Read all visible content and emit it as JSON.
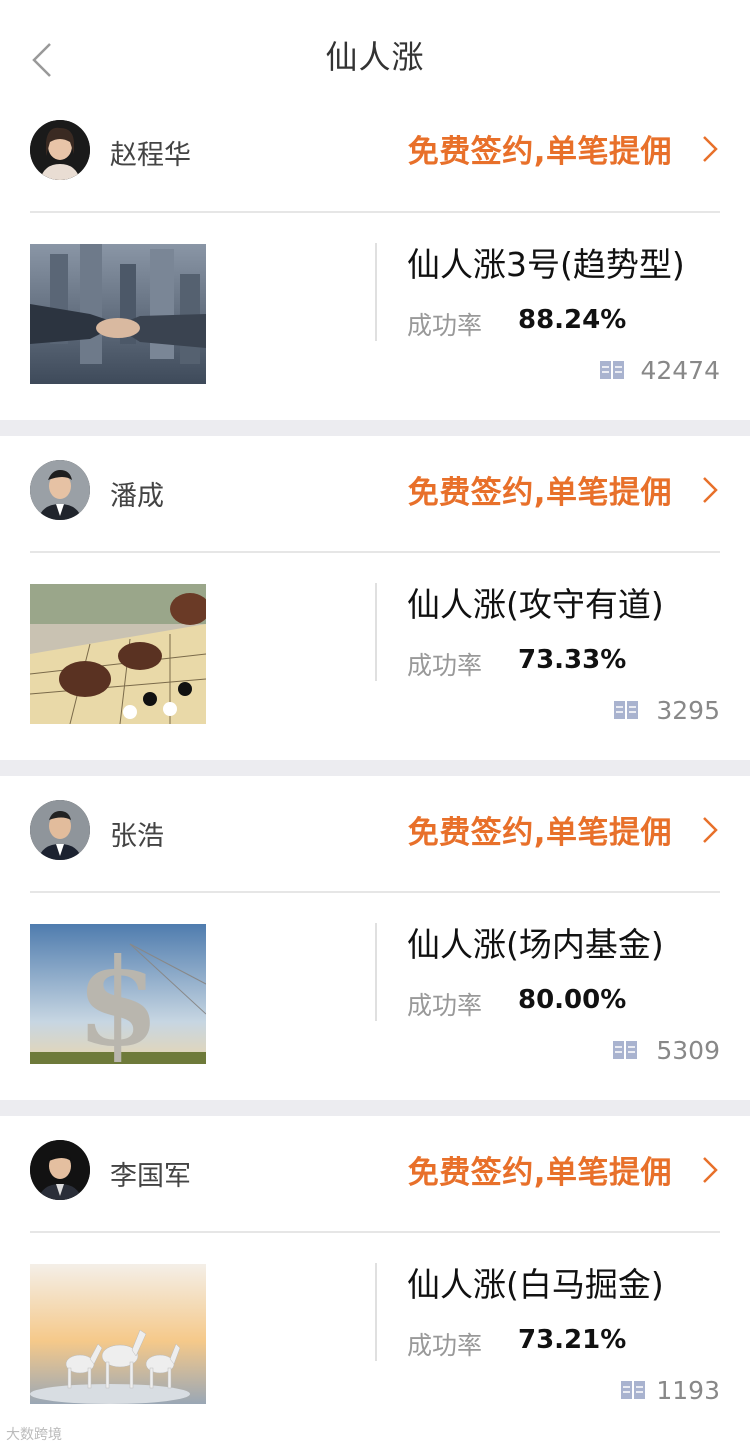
{
  "nav": {
    "title": "仙人涨"
  },
  "cards": [
    {
      "author": "赵程华",
      "promo": "免费签约,单笔提佣",
      "title": "仙人涨3号(趋势型)",
      "rate_label": "成功率",
      "rate_value": "88.24%",
      "views": "42474"
    },
    {
      "author": "潘成",
      "promo": "免费签约,单笔提佣",
      "title": "仙人涨(攻守有道)",
      "rate_label": "成功率",
      "rate_value": "73.33%",
      "views": "3295"
    },
    {
      "author": "张浩",
      "promo": "免费签约,单笔提佣",
      "title": "仙人涨(场内基金)",
      "rate_label": "成功率",
      "rate_value": "80.00%",
      "views": "5309"
    },
    {
      "author": "李国军",
      "promo": "免费签约,单笔提佣",
      "title": "仙人涨(白马掘金)",
      "rate_label": "成功率",
      "rate_value": "73.21%",
      "views": "1193"
    }
  ],
  "watermark": "大数跨境",
  "colors": {
    "accent": "#e8702a",
    "separator": "#ececf0",
    "icon": "#a9b3cf"
  }
}
